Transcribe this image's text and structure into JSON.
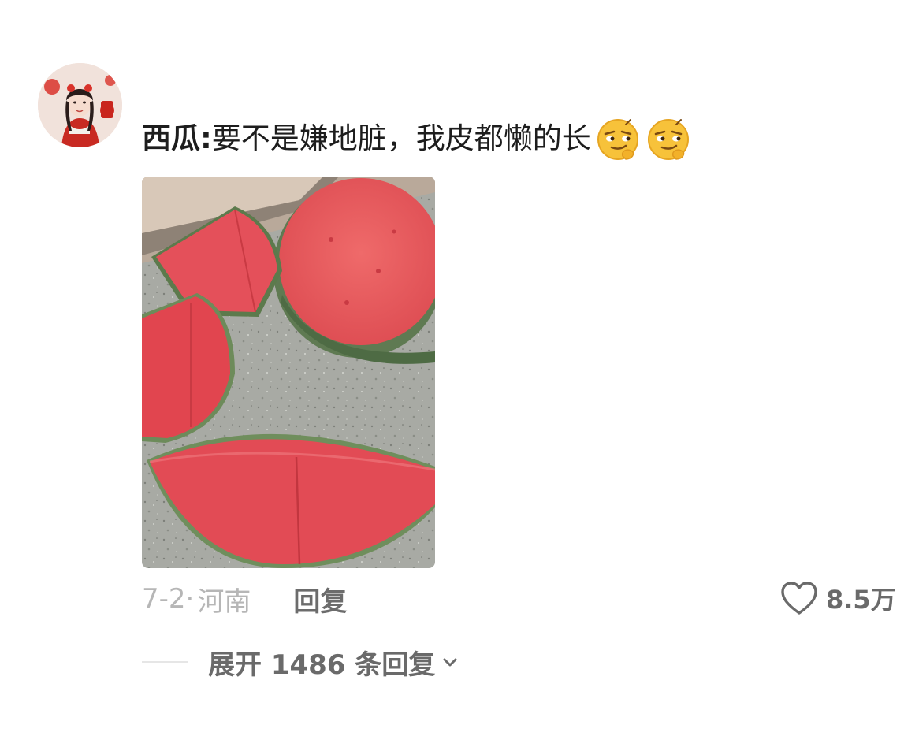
{
  "comment": {
    "username": "西瓜",
    "separator": ": ",
    "text": "要不是嫌地脏，我皮都懒的长",
    "emojis": [
      "smirk-emoji",
      "smirk-emoji"
    ],
    "date": "7-2·",
    "location": "河南",
    "reply_label": "回复",
    "like_count": "8.5万",
    "expand_label": "展开 1486 条回复"
  },
  "icons": {
    "like": "heart-outline-icon",
    "expand": "chevron-down-icon"
  },
  "colors": {
    "text_primary": "#1d1d1d",
    "text_meta": "#b6b6b6",
    "text_secondary": "#6a6a6a"
  }
}
